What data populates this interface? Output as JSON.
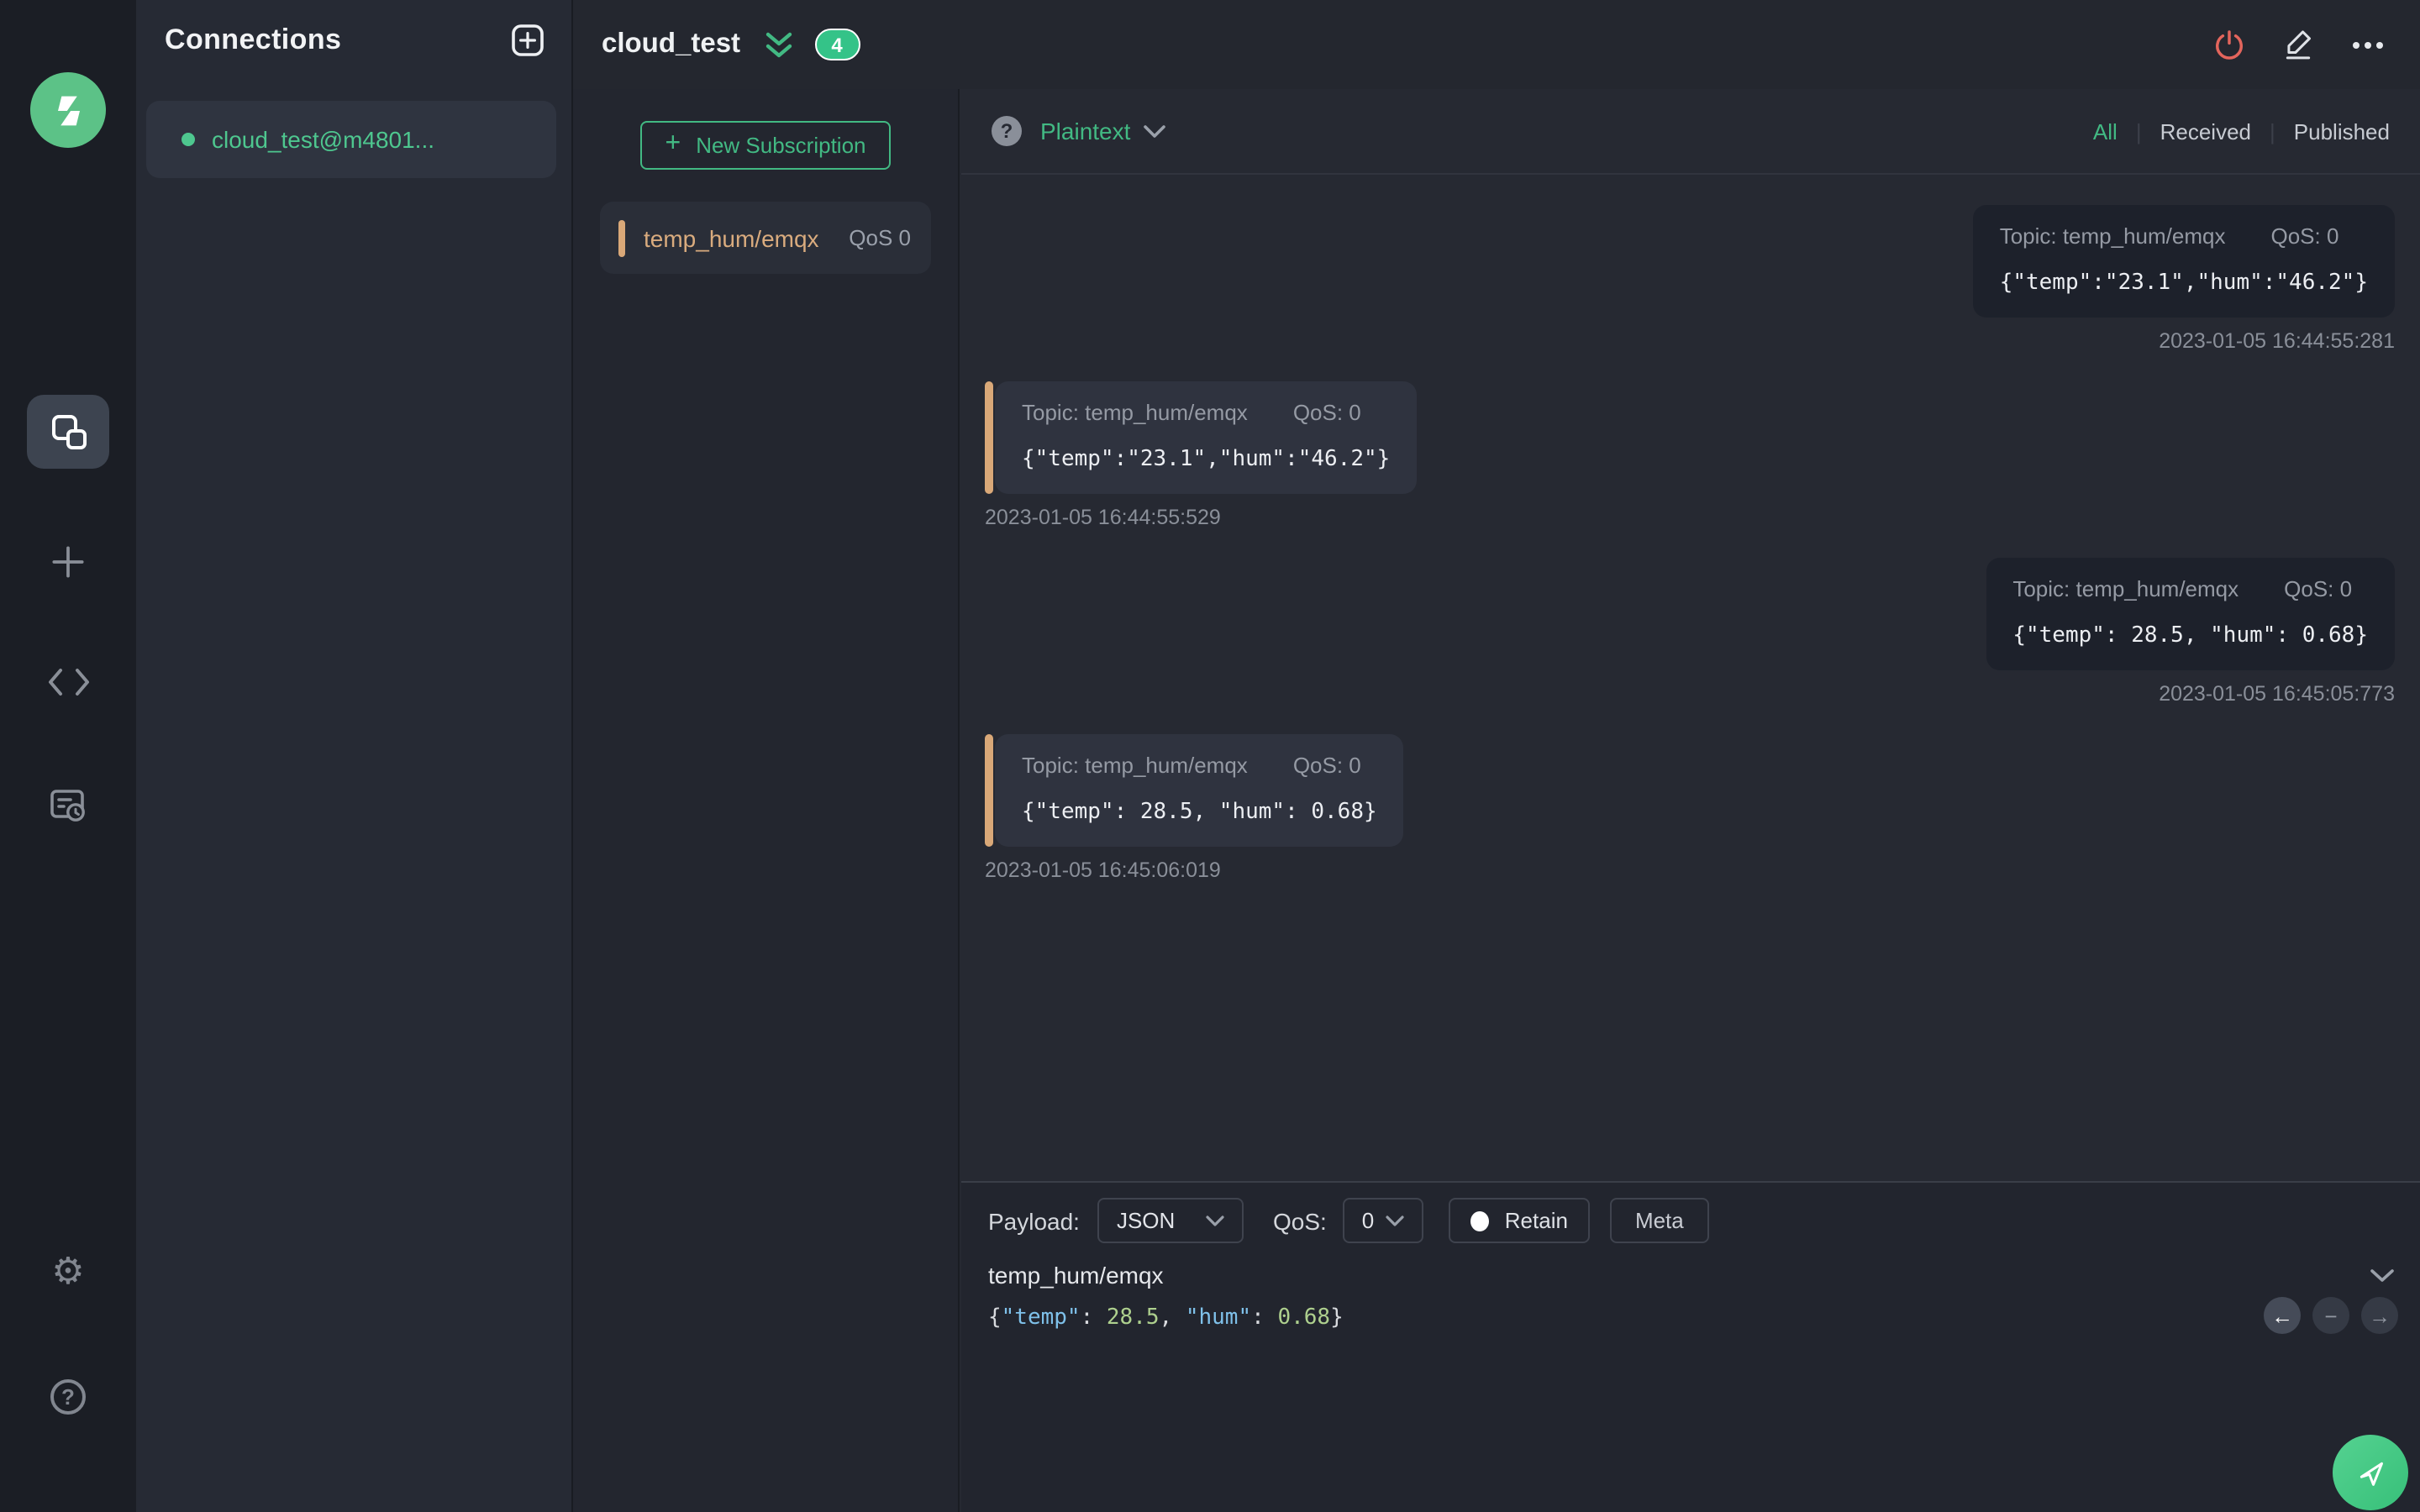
{
  "colors": {
    "accent": "#34c388",
    "received_bar": "#d9a878",
    "power_red": "#e3655c"
  },
  "icons": {
    "plus_glyph": "+",
    "gear_glyph": "⚙",
    "help_glyph": "?",
    "back_glyph": "←",
    "minus_glyph": "−",
    "forward_glyph": "→"
  },
  "connections": {
    "title": "Connections",
    "item": {
      "name": "cloud_test@m4801..."
    }
  },
  "header": {
    "title": "cloud_test",
    "badge": "4"
  },
  "subscriptions": {
    "new_label": "New Subscription",
    "item": {
      "topic": "temp_hum/emqx",
      "qos": "QoS 0"
    }
  },
  "toolbar": {
    "help_glyph": "?",
    "format": "Plaintext",
    "filter_all": "All",
    "filter_received": "Received",
    "filter_published": "Published"
  },
  "messages": [
    {
      "direction": "published",
      "topic": "Topic: temp_hum/emqx",
      "qos": "QoS: 0",
      "payload": "{\"temp\":\"23.1\",\"hum\":\"46.2\"}",
      "time": "2023-01-05 16:44:55:281"
    },
    {
      "direction": "received",
      "topic": "Topic: temp_hum/emqx",
      "qos": "QoS: 0",
      "payload": "{\"temp\":\"23.1\",\"hum\":\"46.2\"}",
      "time": "2023-01-05 16:44:55:529"
    },
    {
      "direction": "published",
      "topic": "Topic: temp_hum/emqx",
      "qos": "QoS: 0",
      "payload": "{\"temp\": 28.5, \"hum\": 0.68}",
      "time": "2023-01-05 16:45:05:773"
    },
    {
      "direction": "received",
      "topic": "Topic: temp_hum/emqx",
      "qos": "QoS: 0",
      "payload": "{\"temp\": 28.5, \"hum\": 0.68}",
      "time": "2023-01-05 16:45:06:019"
    }
  ],
  "publish": {
    "payload_label": "Payload:",
    "format_value": "JSON",
    "qos_label": "QoS:",
    "qos_value": "0",
    "retain_label": "Retain",
    "meta_label": "Meta",
    "topic_value": "temp_hum/emqx",
    "editor": {
      "segments": [
        {
          "text": "{",
          "type": "punct"
        },
        {
          "text": "\"temp\"",
          "type": "key"
        },
        {
          "text": ": ",
          "type": "punct"
        },
        {
          "text": "28.5",
          "type": "number"
        },
        {
          "text": ", ",
          "type": "punct"
        },
        {
          "text": "\"hum\"",
          "type": "key"
        },
        {
          "text": ": ",
          "type": "punct"
        },
        {
          "text": "0.68",
          "type": "number"
        },
        {
          "text": "}",
          "type": "punct"
        }
      ]
    }
  }
}
